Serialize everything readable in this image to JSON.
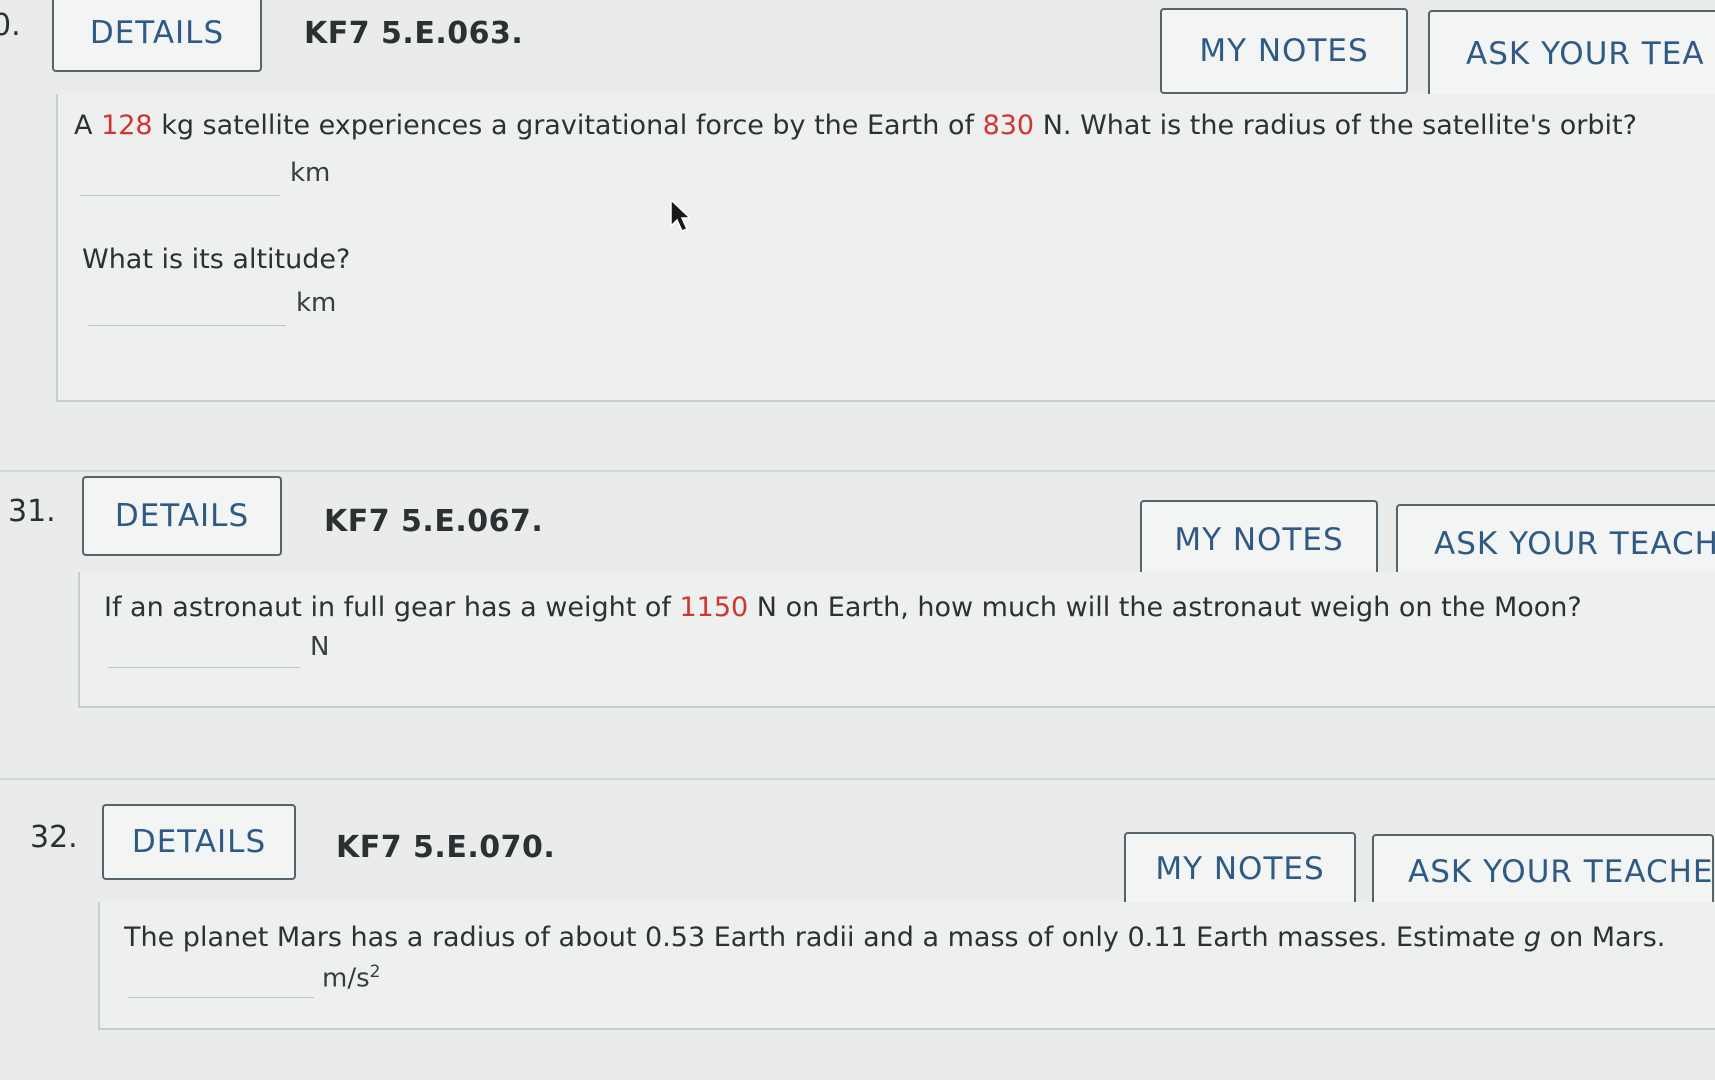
{
  "questions": [
    {
      "number": "0.",
      "details_label": "DETAILS",
      "code": "KF7 5.E.063.",
      "my_notes_label": "MY NOTES",
      "ask_label": "ASK YOUR TEA",
      "prompt": {
        "pre": "A ",
        "val1": "128",
        "mid": " kg satellite experiences a gravitational force by the Earth of ",
        "val2": "830",
        "post": " N. What is the radius of the satellite's orbit?"
      },
      "unit1": "km",
      "sub_prompt": "What is its altitude?",
      "unit2": "km"
    },
    {
      "number": "31.",
      "details_label": "DETAILS",
      "code": "KF7 5.E.067.",
      "my_notes_label": "MY NOTES",
      "ask_label": "ASK YOUR TEACHI",
      "prompt": {
        "pre": "If an astronaut in full gear has a weight of ",
        "val1": "1150",
        "post": " N on Earth, how much will the astronaut weigh on the Moon?"
      },
      "unit1": "N"
    },
    {
      "number": "32.",
      "details_label": "DETAILS",
      "code": "KF7 5.E.070.",
      "my_notes_label": "MY NOTES",
      "ask_label": "ASK YOUR TEACHEF",
      "prompt": {
        "pre": "The planet Mars has a radius of about 0.53 Earth radii and a mass of only 0.11 Earth masses. Estimate ",
        "var": "g",
        "post": " on Mars."
      },
      "unit1_base": "m/s",
      "unit1_exp": "2"
    }
  ],
  "colors": {
    "accent_red": "#d0362f",
    "button_text": "#2f5a85",
    "background": "#e9ecea"
  },
  "icons": {
    "mouse_cursor": "arrow-pointer"
  }
}
